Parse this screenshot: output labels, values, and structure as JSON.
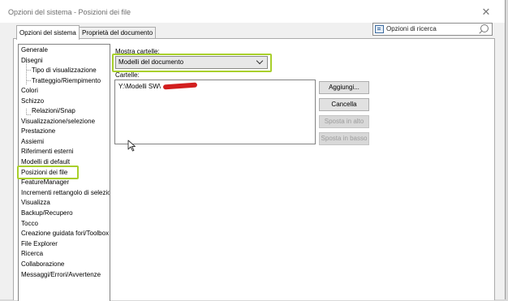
{
  "window": {
    "title": "Opzioni del sistema - Posizioni dei file",
    "close_glyph": "✕",
    "close_icon": "close-icon"
  },
  "tabs": [
    {
      "label": "Opzioni del sistema",
      "active": true
    },
    {
      "label": "Proprietà del documento",
      "active": false
    }
  ],
  "search": {
    "placeholder": "Opzioni di ricerca",
    "icon_left": "options-search-icon",
    "icon_right": "magnifier-icon"
  },
  "tree": {
    "items": [
      {
        "label": "Generale"
      },
      {
        "label": "Disegni"
      },
      {
        "label": "Tipo di visualizzazione",
        "child": true
      },
      {
        "label": "Tratteggio/Riempimento",
        "child": true
      },
      {
        "label": "Colori"
      },
      {
        "label": "Schizzo"
      },
      {
        "label": "Relazioni/Snap",
        "child": true
      },
      {
        "label": "Visualizzazione/selezione"
      },
      {
        "label": "Prestazione"
      },
      {
        "label": "Assiemi"
      },
      {
        "label": "Riferimenti esterni"
      },
      {
        "label": "Modelli di default"
      },
      {
        "label": "Posizioni dei file",
        "selected": true
      },
      {
        "label": "FeatureManager"
      },
      {
        "label": "Incrementi rettangolo di selezione"
      },
      {
        "label": "Visualizza"
      },
      {
        "label": "Backup/Recupero"
      },
      {
        "label": "Tocco"
      },
      {
        "label": "Creazione guidata fori/Toolbox"
      },
      {
        "label": "File Explorer"
      },
      {
        "label": "Ricerca"
      },
      {
        "label": "Collaborazione"
      },
      {
        "label": "Messaggi/Errori/Avvertenze"
      }
    ]
  },
  "main": {
    "show_folders_label": "Mostra cartelle:",
    "show_folders_value": "Modelli del documento",
    "folders_label": "Cartelle:",
    "folders": [
      "Y:\\Modelli SW\\"
    ],
    "buttons": {
      "add": "Aggiungi...",
      "delete": "Cancella",
      "move_up": "Sposta in alto",
      "move_down": "Sposta in basso"
    }
  },
  "colors": {
    "highlight": "#a8cf2b",
    "redaction": "#d21f1f"
  }
}
